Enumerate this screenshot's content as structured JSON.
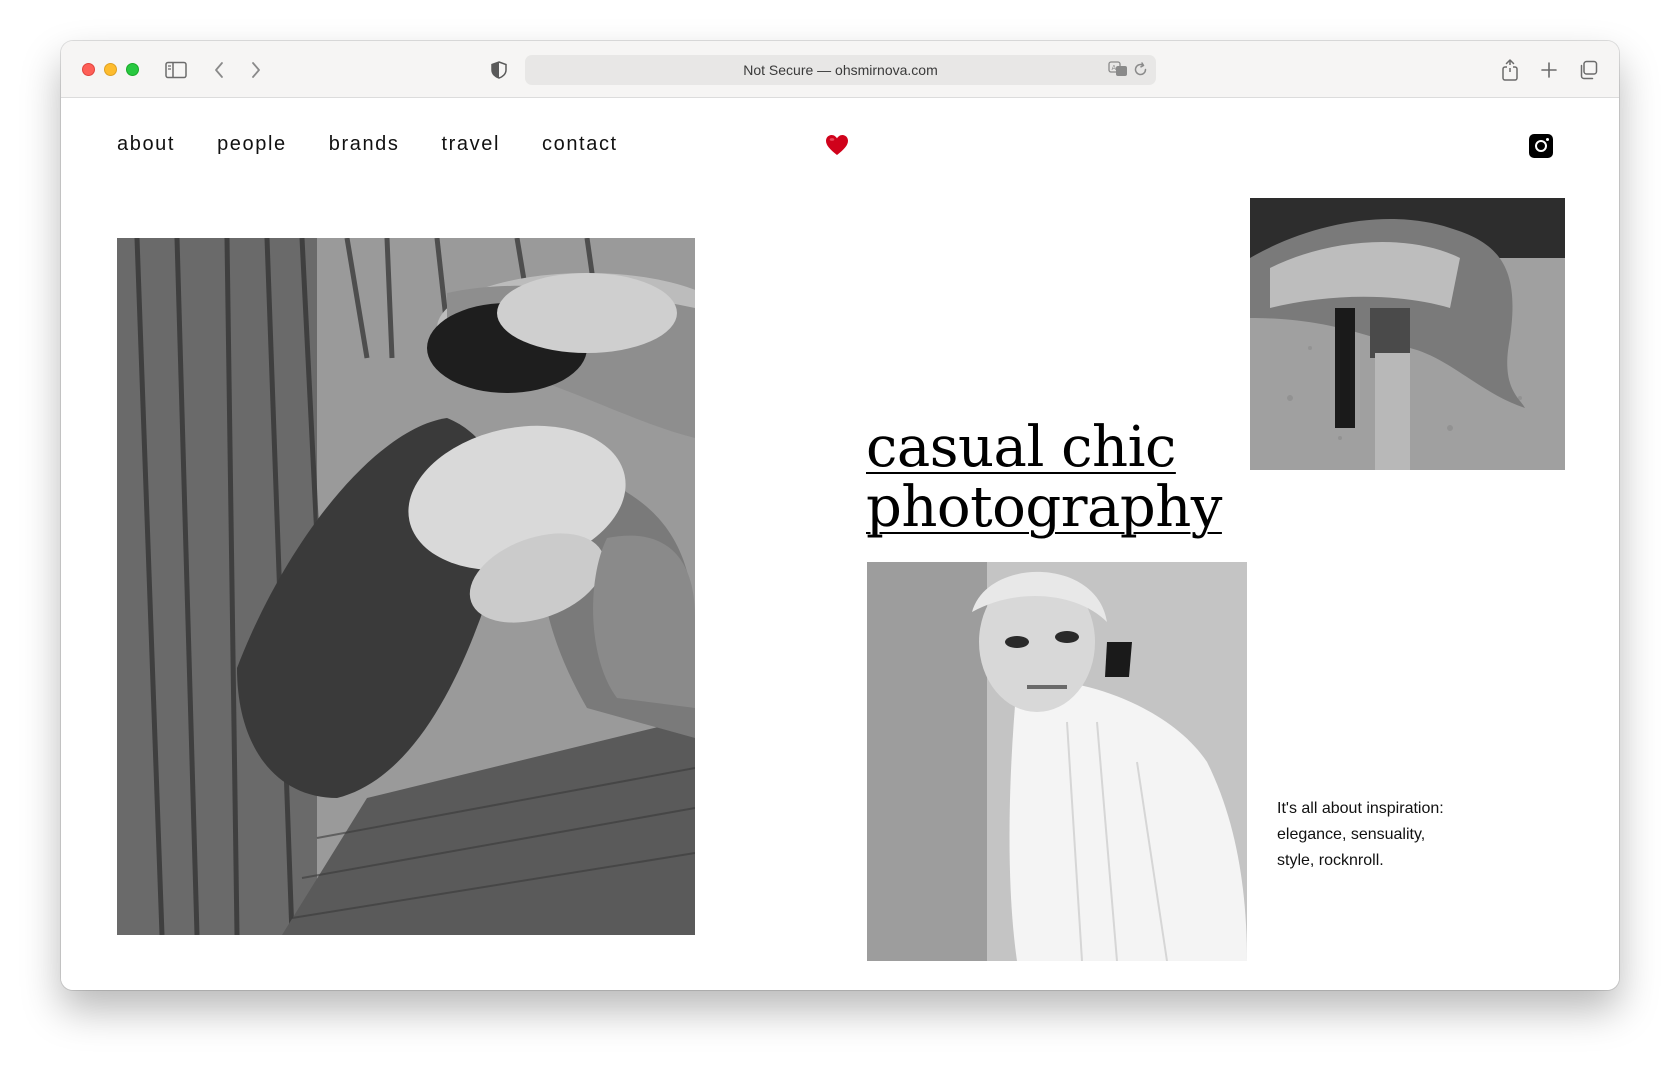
{
  "browser": {
    "url_text": "Not Secure — ohsmirnova.com",
    "traffic_lights": [
      "#fe5f57",
      "#febc2e",
      "#28c840"
    ]
  },
  "nav": {
    "items": [
      {
        "label": "about"
      },
      {
        "label": "people"
      },
      {
        "label": "brands"
      },
      {
        "label": "travel"
      },
      {
        "label": "contact"
      }
    ]
  },
  "hero": {
    "headline_line1": "casual chic",
    "headline_line2": "photography",
    "tagline": "It's all about inspiration: elegance, sensuality, style, rocknroll."
  },
  "icons": {
    "logo": "heart-icon",
    "social": "instagram-icon",
    "heart_color": "#d0021b"
  }
}
